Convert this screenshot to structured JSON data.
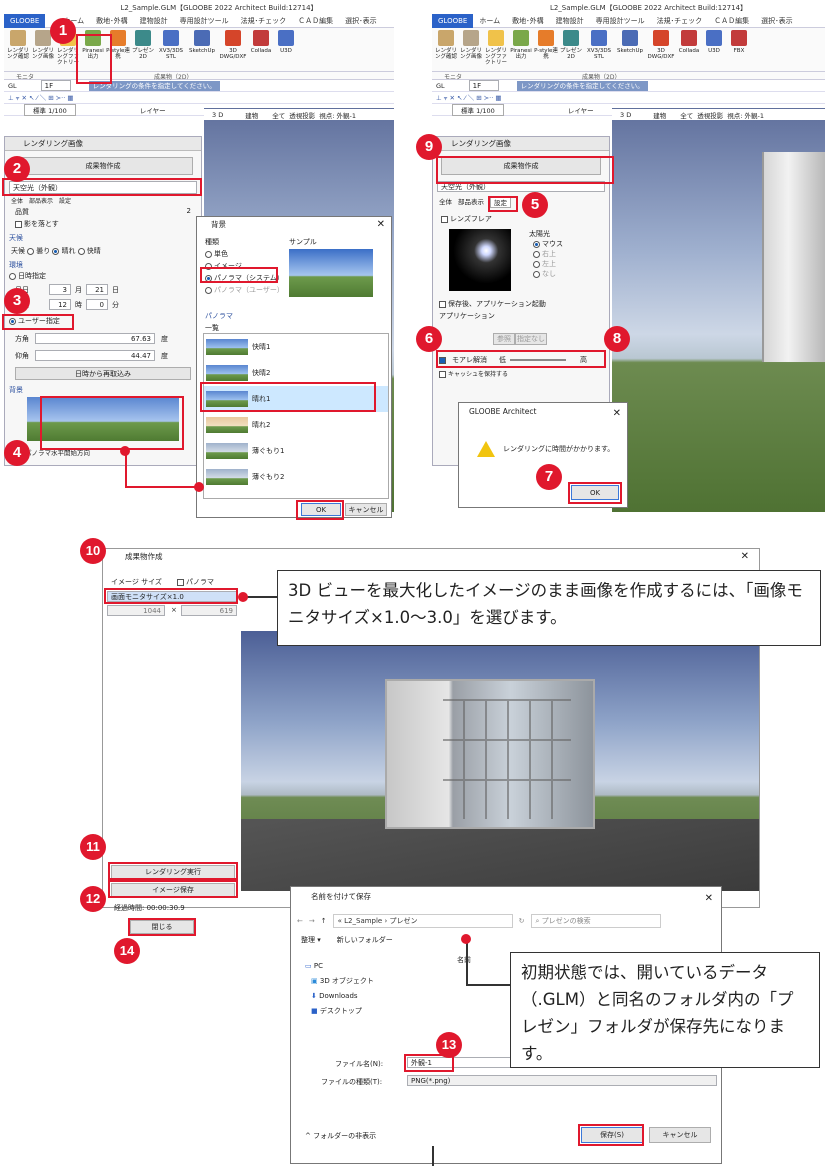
{
  "app": {
    "title": "L2_Sample.GLM【GLOOBE 2022 Architect Build:12714】",
    "tabs": [
      "GLOOBE",
      "ホーム",
      "敷地･外構",
      "建物設計",
      "専用設計ツール",
      "法規･チェック",
      "ＣＡＤ編集",
      "選択･表示"
    ],
    "ribbon_buttons": [
      "レンダリング確認",
      "レンダリング画像",
      "レンダリングファクトリー",
      "Piranesi出力",
      "P-style連携",
      "プレゼン2D",
      "XV3/3DS STL",
      "SketchUp",
      "3D DWG/DXF",
      "Collada",
      "U3D",
      "FBX"
    ],
    "group_labels": [
      "モニタ",
      "成果物（2D）"
    ],
    "floor": "1F",
    "gl": "GL",
    "status_message": "レンダリングの条件を指定してください。",
    "scale": "標準 1/100",
    "layer": "レイヤー",
    "view_tabs": [
      "3 D",
      "建物",
      "全て",
      "透視投影",
      "視点: 外観-1"
    ]
  },
  "left_panel": {
    "title": "レンダリング画像",
    "create_button": "成果物作成",
    "preset": "天空光（外観）",
    "subtabs": [
      "全体",
      "部品表示",
      "設定"
    ],
    "quality": "品質",
    "quality_value": "2",
    "shadow": "影を落とす",
    "weather_label": "天候",
    "weather_options": [
      "天候",
      "曇り",
      "晴れ",
      "快晴"
    ],
    "environment": "環境",
    "datetime": "日時指定",
    "month_label": "月日",
    "month": "3",
    "month_unit": "月",
    "day": "21",
    "day_unit": "日",
    "time_label": "時刻",
    "hour": "12",
    "hour_unit": "時",
    "minute": "0",
    "minute_unit": "分",
    "user_spec": "ユーザー指定",
    "direction_label": "方角",
    "direction_value": "67.63",
    "elevation_label": "仰角",
    "elevation_value": "44.47",
    "degree_unit": "度",
    "reload_button": "日時から再取込み",
    "background_label": "背景",
    "pano_hint": "パノラマ水平開始方向"
  },
  "bg_dialog": {
    "title": "背景",
    "kind_label": "種類",
    "options": [
      "単色",
      "イメージ",
      "パノラマ（システム）",
      "パノラマ（ユーザー）"
    ],
    "sample_label": "サンプル",
    "panorama_label": "パノラマ",
    "list_label": "一覧",
    "items": [
      "快晴1",
      "快晴2",
      "晴れ1",
      "晴れ2",
      "薄ぐもり1",
      "薄ぐもり2"
    ],
    "ok": "OK",
    "cancel": "キャンセル"
  },
  "right_panel": {
    "subtabs": [
      "全体",
      "部品表示",
      "設定"
    ],
    "lens_flare": "レンズフレア",
    "sun_label": "太陽光",
    "sun_options": [
      "マウス",
      "右上",
      "左上",
      "なし"
    ],
    "save_after": "保存後、アプリケーション起動",
    "application_label": "アプリケーション",
    "browse_button": "参照",
    "unspecified_button": "指定なし",
    "antialias": "モアレ解消",
    "low": "低",
    "high": "高",
    "keep_camera": "キャッシュを保持する"
  },
  "alert": {
    "title": "GLOOBE Architect",
    "message": "レンダリングに時間がかかります。",
    "ok": "OK"
  },
  "create_dialog": {
    "title": "成果物作成",
    "image_size_label": "イメージ サイズ",
    "panorama_check": "パノラマ",
    "size_option": "画面モニタサイズ×1.0",
    "width": "1044",
    "height": "619",
    "render_button": "レンダリング実行",
    "save_button": "イメージ保存",
    "elapsed_label": "経過時間: 00:00:30.9",
    "close_button": "閉じる"
  },
  "save_dialog": {
    "title": "名前を付けて保存",
    "breadcrumb": [
      "L2_Sample",
      "プレゼン"
    ],
    "search_placeholder": "プレゼンの検索",
    "organize": "整理 ▾",
    "new_folder": "新しいフォルダー",
    "tree": [
      "PC",
      "3D オブジェクト",
      "Downloads",
      "デスクトップ"
    ],
    "column_name": "名前",
    "filename_label": "ファイル名(N):",
    "filename": "外観-1",
    "filetype_label": "ファイルの種類(T):",
    "filetype": "PNG(*.png)",
    "hide_folders": "フォルダーの非表示",
    "save": "保存(S)",
    "cancel": "キャンセル"
  },
  "callouts": {
    "size_note": "3D ビューを最大化したイメージのまま画像を作成するには、「画像モニタサイズ×1.0～3.0」を選びます。",
    "folder_note": "初期状態では、開いているデータ（.GLM）と同名のフォルダ内の「プレゼン」フォルダが保存先になります。"
  },
  "badges": [
    "1",
    "2",
    "3",
    "4",
    "5",
    "6",
    "7",
    "8",
    "9",
    "10",
    "11",
    "12",
    "13",
    "14"
  ],
  "colors": {
    "accent_red": "#e0182d",
    "ribbon_blue": "#2b62c8"
  }
}
